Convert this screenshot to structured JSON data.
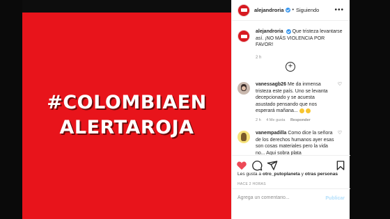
{
  "post": {
    "image_text_line1": "#COLOMBIAEN",
    "image_text_line2": "ALERTAROJA",
    "image_bg_color": "#e8141b"
  },
  "header": {
    "username": "alejandroria",
    "separator": "•",
    "follow_status": "Siguiendo",
    "more_label": "•••"
  },
  "caption": {
    "username": "alejandroria",
    "text": "Que tristeza levantarse así. ¡NO MÁS VIOLENCIA POR FAVOR!",
    "time": "2 h"
  },
  "load_more_label": "+",
  "comments": [
    {
      "username": "vanessagb26",
      "text": "Me da inmensa tristeza este país. Uno se levanta decepcionado y se acuesta asustado pensando que nos esperará mañana...",
      "time": "2 h",
      "likes": "4 Me gusta",
      "reply": "Responder"
    },
    {
      "username": "vanempadilla",
      "text": "Como dice la señora de los derechos humanos ayer esas son cosas materiales pero la vida no... Aqui sobra plata",
      "time": "",
      "likes": "",
      "reply": ""
    }
  ],
  "likes_line": {
    "prefix": "Les gusta a ",
    "user": "otro_putoplaneta",
    "suffix": " y ",
    "others": "otras personas"
  },
  "timestamp": "HACE 2 HORAS",
  "add_comment": {
    "placeholder": "Agrega un comentario...",
    "post_label": "Publicar"
  },
  "colors": {
    "accent_blue": "#3897f0",
    "liked_red": "#ed4956",
    "brand_red": "#d71920"
  },
  "icons": [
    "verified-badge-icon",
    "heart-icon",
    "comment-icon",
    "share-icon",
    "bookmark-icon",
    "plus-circle-icon"
  ]
}
